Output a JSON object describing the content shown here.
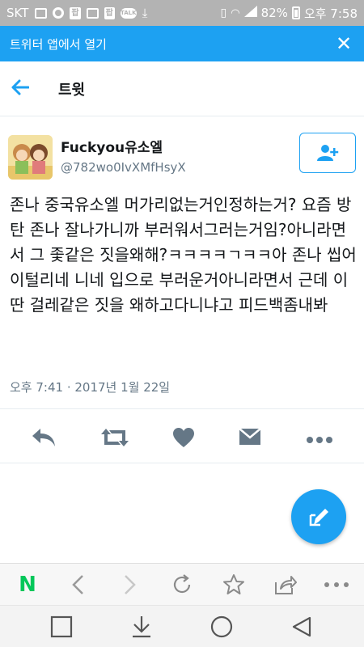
{
  "status_bar": {
    "carrier": "SKT",
    "talk_label": "TALK",
    "pp_label": "팝",
    "battery": "82%",
    "time": "오후 7:58"
  },
  "app_banner": {
    "label": "트위터 앱에서 열기"
  },
  "header": {
    "title": "트윗"
  },
  "tweet": {
    "display_name": "Fuckyou유소엘",
    "handle": "@782wo0IvXMfHsyX",
    "text": "존나 중국유소엘 머가리없는거인정하는거? 요즘 방탄 존나 잘나가니까 부러워서그러는거임?아니라면서 그 좇같은 짓을왜해?ㅋㅋㅋㅋㄱㅋㅋ아 존나 씹어이털리네 니네 입으로 부러운거아니라면서 근데 이딴 걸레같은 짓을 왜하고다니냐고 피드백좀내봐",
    "date": "오후 7:41 · 2017년 1월 22일"
  },
  "colors": {
    "accent": "#1da1f2",
    "icon_gray": "#657786",
    "naver_green": "#03c75a"
  },
  "icons": {
    "reply": "reply-icon",
    "retweet": "retweet-icon",
    "like": "heart-icon",
    "dm": "envelope-icon",
    "more": "more-icon"
  }
}
